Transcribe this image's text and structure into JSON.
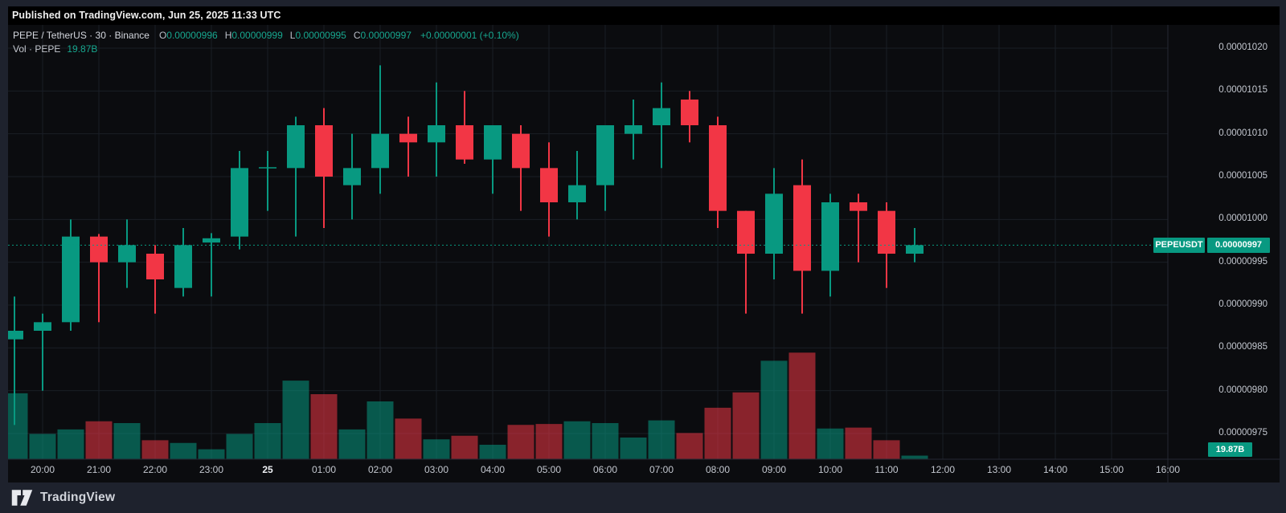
{
  "banner": {
    "text": "Published on TradingView.com, Jun 25, 2025 11:33 UTC"
  },
  "legend": {
    "symbol": "PEPE / TetherUS",
    "interval": "30",
    "exchange": "Binance",
    "separator": "·",
    "ohlc": [
      {
        "label": "O",
        "value": "0.00000996"
      },
      {
        "label": "H",
        "value": "0.00000999"
      },
      {
        "label": "L",
        "value": "0.00000995"
      },
      {
        "label": "C",
        "value": "0.00000997"
      }
    ],
    "change": "+0.00000001 (+0.10%)",
    "vol_label": "Vol · PEPE",
    "vol_value": "19.87B"
  },
  "price_axis": {
    "badge": {
      "symbol": "PEPEUSDT",
      "price": "0.00000997"
    },
    "volume_badge": "19.87B"
  },
  "footer": {
    "brand": "TradingView"
  },
  "colors": {
    "up": "#089981",
    "down": "#f23645",
    "badge": "#089981",
    "grid": "#1a1e26",
    "axis_border": "#242833",
    "background": "#0b0c0f",
    "frame": "#1e222d"
  },
  "chart_data": {
    "type": "candlestick",
    "title": "PEPE / TetherUS · 30 · Binance",
    "interval_minutes": 30,
    "current_price": 9.97e-06,
    "current_volume_label": "19.87B",
    "ylim": [
      9.75e-06,
      1.02e-05
    ],
    "y_tick_labels": [
      "0.00001020",
      "0.00001015",
      "0.00001010",
      "0.00001005",
      "0.00001000",
      "0.00000995",
      "0.00000990",
      "0.00000985",
      "0.00000980",
      "0.00000975"
    ],
    "x_tick_labels": [
      "20:00",
      "21:00",
      "22:00",
      "23:00",
      "25",
      "01:00",
      "02:00",
      "03:00",
      "04:00",
      "05:00",
      "06:00",
      "07:00",
      "08:00",
      "09:00",
      "10:00",
      "11:00",
      "12:00",
      "13:00",
      "14:00",
      "15:00",
      "16:00"
    ],
    "day_label": "25",
    "volume_unit": "B (PEPE, estimated from 19.87B current bar)",
    "candles": [
      {
        "t": "19:30",
        "o": 9.86e-06,
        "h": 9.91e-06,
        "l": 9.76e-06,
        "c": 9.87e-06,
        "v": 365
      },
      {
        "t": "20:00",
        "o": 9.87e-06,
        "h": 9.89e-06,
        "l": 9.8e-06,
        "c": 9.88e-06,
        "v": 140
      },
      {
        "t": "20:30",
        "o": 9.88e-06,
        "h": 1e-05,
        "l": 9.87e-06,
        "c": 9.98e-06,
        "v": 165
      },
      {
        "t": "21:00",
        "o": 9.98e-06,
        "h": 9.983e-06,
        "l": 9.88e-06,
        "c": 9.95e-06,
        "v": 210
      },
      {
        "t": "21:30",
        "o": 9.95e-06,
        "h": 1e-05,
        "l": 9.92e-06,
        "c": 9.97e-06,
        "v": 200
      },
      {
        "t": "22:00",
        "o": 9.96e-06,
        "h": 9.97e-06,
        "l": 9.89e-06,
        "c": 9.93e-06,
        "v": 105
      },
      {
        "t": "22:30",
        "o": 9.92e-06,
        "h": 9.99e-06,
        "l": 9.91e-06,
        "c": 9.97e-06,
        "v": 90
      },
      {
        "t": "23:00",
        "o": 9.973e-06,
        "h": 9.984e-06,
        "l": 9.91e-06,
        "c": 9.978e-06,
        "v": 55
      },
      {
        "t": "23:30",
        "o": 9.98e-06,
        "h": 1.008e-05,
        "l": 9.965e-06,
        "c": 1.006e-05,
        "v": 140
      },
      {
        "t": "00:00",
        "o": 1.006e-05,
        "h": 1.008e-05,
        "l": 1.001e-05,
        "c": 1.0061e-05,
        "v": 200
      },
      {
        "t": "00:30",
        "o": 1.006e-05,
        "h": 1.012e-05,
        "l": 9.98e-06,
        "c": 1.011e-05,
        "v": 435
      },
      {
        "t": "01:00",
        "o": 1.011e-05,
        "h": 1.013e-05,
        "l": 9.99e-06,
        "c": 1.005e-05,
        "v": 360
      },
      {
        "t": "01:30",
        "o": 1.004e-05,
        "h": 1.01e-05,
        "l": 1e-05,
        "c": 1.006e-05,
        "v": 165
      },
      {
        "t": "02:00",
        "o": 1.006e-05,
        "h": 1.018e-05,
        "l": 1.003e-05,
        "c": 1.01e-05,
        "v": 320
      },
      {
        "t": "02:30",
        "o": 1.01e-05,
        "h": 1.012e-05,
        "l": 1.005e-05,
        "c": 1.009e-05,
        "v": 225
      },
      {
        "t": "03:00",
        "o": 1.009e-05,
        "h": 1.016e-05,
        "l": 1.005e-05,
        "c": 1.011e-05,
        "v": 110
      },
      {
        "t": "03:30",
        "o": 1.011e-05,
        "h": 1.015e-05,
        "l": 1.0065e-05,
        "c": 1.007e-05,
        "v": 130
      },
      {
        "t": "04:00",
        "o": 1.007e-05,
        "h": 1.011e-05,
        "l": 1.003e-05,
        "c": 1.011e-05,
        "v": 80
      },
      {
        "t": "04:30",
        "o": 1.01e-05,
        "h": 1.011e-05,
        "l": 1.001e-05,
        "c": 1.006e-05,
        "v": 190
      },
      {
        "t": "05:00",
        "o": 1.006e-05,
        "h": 1.009e-05,
        "l": 9.98e-06,
        "c": 1.002e-05,
        "v": 195
      },
      {
        "t": "05:30",
        "o": 1.002e-05,
        "h": 1.008e-05,
        "l": 1e-05,
        "c": 1.004e-05,
        "v": 210
      },
      {
        "t": "06:00",
        "o": 1.004e-05,
        "h": 1.011e-05,
        "l": 1.001e-05,
        "c": 1.011e-05,
        "v": 200
      },
      {
        "t": "06:30",
        "o": 1.01e-05,
        "h": 1.014e-05,
        "l": 1.007e-05,
        "c": 1.011e-05,
        "v": 120
      },
      {
        "t": "07:00",
        "o": 1.011e-05,
        "h": 1.016e-05,
        "l": 1.006e-05,
        "c": 1.013e-05,
        "v": 215
      },
      {
        "t": "07:30",
        "o": 1.014e-05,
        "h": 1.015e-05,
        "l": 1.009e-05,
        "c": 1.011e-05,
        "v": 145
      },
      {
        "t": "08:00",
        "o": 1.011e-05,
        "h": 1.012e-05,
        "l": 9.99e-06,
        "c": 1.001e-05,
        "v": 285
      },
      {
        "t": "08:30",
        "o": 1.001e-05,
        "h": 1.001e-05,
        "l": 9.89e-06,
        "c": 9.96e-06,
        "v": 370
      },
      {
        "t": "09:00",
        "o": 9.96e-06,
        "h": 1.006e-05,
        "l": 9.93e-06,
        "c": 1.003e-05,
        "v": 545
      },
      {
        "t": "09:30",
        "o": 1.004e-05,
        "h": 1.007e-05,
        "l": 9.89e-06,
        "c": 9.94e-06,
        "v": 590
      },
      {
        "t": "10:00",
        "o": 9.94e-06,
        "h": 1.003e-05,
        "l": 9.91e-06,
        "c": 1.002e-05,
        "v": 170
      },
      {
        "t": "10:30",
        "o": 1.002e-05,
        "h": 1.003e-05,
        "l": 9.95e-06,
        "c": 1.001e-05,
        "v": 175
      },
      {
        "t": "11:00",
        "o": 1.001e-05,
        "h": 1.002e-05,
        "l": 9.92e-06,
        "c": 9.96e-06,
        "v": 105
      },
      {
        "t": "11:30",
        "o": 9.96e-06,
        "h": 9.99e-06,
        "l": 9.95e-06,
        "c": 9.97e-06,
        "v": 19.87
      }
    ]
  }
}
